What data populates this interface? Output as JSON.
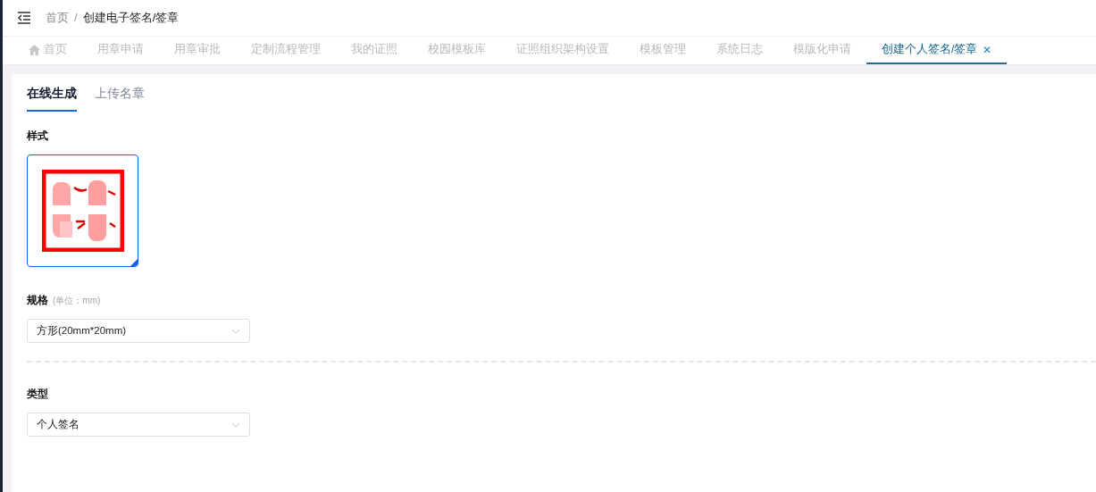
{
  "breadcrumb": [
    {
      "label": "首页",
      "current": false
    },
    {
      "label": "/",
      "kind": "separator"
    },
    {
      "label": "创建电子签名/签章",
      "current": true
    }
  ],
  "tabs": [
    {
      "label": "首页",
      "kind": "home",
      "selected": false
    },
    {
      "label": "用章申请",
      "selected": false
    },
    {
      "label": "用章审批",
      "selected": false
    },
    {
      "label": "定制流程管理",
      "selected": false
    },
    {
      "label": "我的证照",
      "selected": false
    },
    {
      "label": "校园模板库",
      "selected": false
    },
    {
      "label": "证照组织架构设置",
      "selected": false
    },
    {
      "label": "模板管理",
      "selected": false
    },
    {
      "label": "系统日志",
      "selected": false
    },
    {
      "label": "模版化申请",
      "selected": false
    },
    {
      "label": "创建个人签名/签章",
      "selected": true,
      "close": "✕"
    }
  ],
  "subtabs": [
    {
      "label": "在线生成",
      "selected": true
    },
    {
      "label": "上传名章",
      "selected": false
    }
  ],
  "style": {
    "label": "样式",
    "options": [
      {
        "kind": "picture",
        "selected": true
      }
    ]
  },
  "size": {
    "label": "规格",
    "hint": "(单位：mm)",
    "value": "方形(20mm*20mm)"
  },
  "type": {
    "label": "类型",
    "value": "个人签名"
  }
}
